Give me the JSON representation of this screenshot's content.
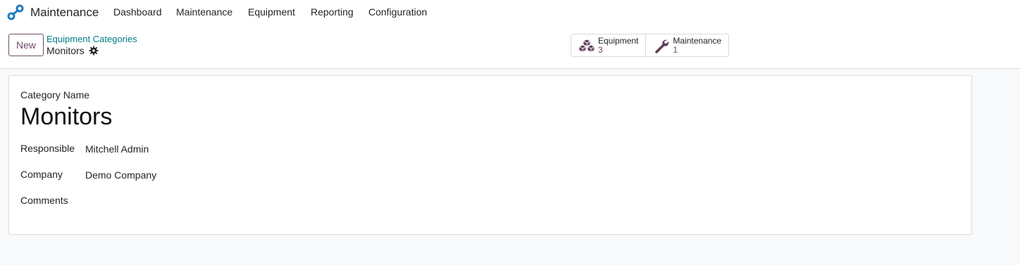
{
  "app": {
    "name": "Maintenance"
  },
  "nav": {
    "items": [
      {
        "label": "Dashboard"
      },
      {
        "label": "Maintenance"
      },
      {
        "label": "Equipment"
      },
      {
        "label": "Reporting"
      },
      {
        "label": "Configuration"
      }
    ]
  },
  "control_panel": {
    "new_label": "New",
    "breadcrumb_parent": "Equipment Categories",
    "breadcrumb_current": "Monitors"
  },
  "smart_buttons": [
    {
      "label": "Equipment",
      "count": "3",
      "icon": "cubes-icon"
    },
    {
      "label": "Maintenance",
      "count": "1",
      "icon": "wrench-icon"
    }
  ],
  "form": {
    "name_label": "Category Name",
    "name_value": "Monitors",
    "fields": [
      {
        "label": "Responsible",
        "value": "Mitchell Admin"
      },
      {
        "label": "Company",
        "value": "Demo Company"
      },
      {
        "label": "Comments",
        "value": ""
      }
    ]
  },
  "colors": {
    "brand": "#714b67",
    "link": "#017e84",
    "logo": "#1f7bc1"
  }
}
